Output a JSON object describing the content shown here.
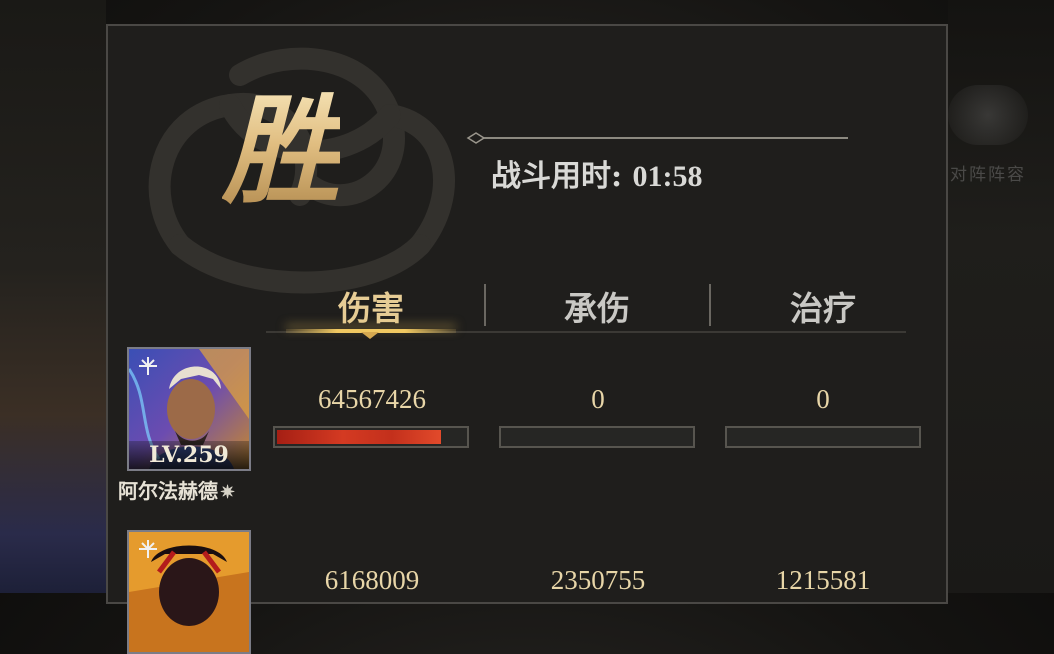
{
  "result": {
    "victory_char": "胜"
  },
  "battle_time": {
    "label": "战斗用时:",
    "value": "01:58"
  },
  "background": {
    "emblem_text": "对阵阵容"
  },
  "tabs": [
    {
      "label": "伤害",
      "active": true
    },
    {
      "label": "承伤",
      "active": false
    },
    {
      "label": "治疗",
      "active": false
    }
  ],
  "heroes": [
    {
      "name": "阿尔法赫德",
      "level": "LV.259",
      "class_icon": "bow-class-icon",
      "damage": "64567426",
      "damage_taken": "0",
      "healing": "0",
      "damage_bar_fraction": 0.87,
      "damage_taken_bar_fraction": 0,
      "healing_bar_fraction": 0
    },
    {
      "name": "",
      "level": "",
      "class_icon": "bow-class-icon",
      "damage": "6168009",
      "damage_taken": "2350755",
      "healing": "1215581"
    }
  ],
  "colors": {
    "accent_gold": "#e6cc95",
    "bar_red": "#d43a22",
    "panel_bg": "#1f1e1c"
  }
}
